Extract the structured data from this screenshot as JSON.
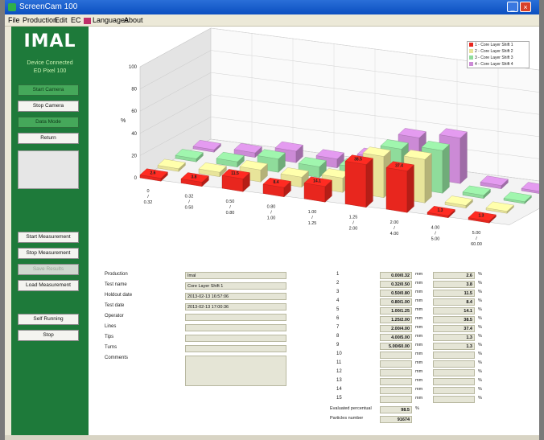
{
  "window": {
    "title": "ScreenCam 100"
  },
  "menu": [
    "File",
    "Production",
    "Edit",
    "EC",
    "Languages",
    "About"
  ],
  "sidebar": {
    "logo": "IMAL",
    "sub1": "Device Connected",
    "sub2": "ED Pixel 100",
    "buttons_top": [
      {
        "label": "Start Camera",
        "state": "active"
      },
      {
        "label": "Stop Camera",
        "state": "normal"
      },
      {
        "label": "Data Mode",
        "state": "active"
      },
      {
        "label": "Return",
        "state": "normal"
      }
    ],
    "buttons_bottom": [
      {
        "label": "Start Measurement",
        "state": "normal"
      },
      {
        "label": "Stop Measurement",
        "state": "normal"
      },
      {
        "label": "Save Results",
        "state": "disabled"
      },
      {
        "label": "Load Measurement",
        "state": "normal"
      },
      {
        "label": "Self Running",
        "state": "normal"
      },
      {
        "label": "Stop",
        "state": "normal"
      }
    ]
  },
  "chart_data": {
    "type": "bar",
    "ylabel": "%",
    "ylim": [
      0,
      100
    ],
    "yticks": [
      0,
      20,
      40,
      60,
      80,
      100
    ],
    "categories": [
      "0 / 0.32",
      "0.32 / 0.50",
      "0.50 / 0.80",
      "0.80 / 1.00",
      "1.00 / 1.25",
      "1.25 / 2.00",
      "2.00 / 4.00",
      "4.00 / 5.00",
      "5.00 / 60.00"
    ],
    "series": [
      {
        "name": "1 - Core Layer Shift 1",
        "color": "#e8261e",
        "values": [
          2.6,
          3.8,
          11.5,
          8.4,
          14.1,
          38.5,
          37.4,
          1.3,
          1.3
        ],
        "labels": [
          "2.6",
          "3.8",
          "11.5",
          "8.4",
          "14.1",
          "38.5",
          "37.4",
          "1.3",
          "1.3"
        ]
      },
      {
        "name": "2 - Core Layer Shift 2",
        "color": "#e8e49a",
        "values": [
          2.5,
          4.0,
          10.8,
          9.0,
          12.9,
          37.1,
          39.1,
          2.4,
          1.5
        ],
        "labels": []
      },
      {
        "name": "3 - Core Layer Shift 3",
        "color": "#8fdc9b",
        "values": [
          2.8,
          4.8,
          12.0,
          9.7,
          13.2,
          35.0,
          38.4,
          2.8,
          1.8
        ],
        "labels": []
      },
      {
        "name": "4 - Core Layer Shift 4",
        "color": "#cc8ad6",
        "values": [
          2.2,
          4.1,
          10.3,
          8.0,
          14.0,
          36.5,
          41.0,
          3.0,
          2.0
        ],
        "labels": []
      }
    ]
  },
  "fields": [
    {
      "label": "Production",
      "value": "Imal"
    },
    {
      "label": "Test name",
      "value": "Core Layer Shift 1"
    },
    {
      "label": "Holdout date",
      "value": "2013-02-13 16:57:06"
    },
    {
      "label": "Test date",
      "value": "2013-02-13 17:00:36"
    },
    {
      "label": "Operator",
      "value": ""
    },
    {
      "label": "Lines",
      "value": ""
    },
    {
      "label": "Tips",
      "value": ""
    },
    {
      "label": "Turns",
      "value": ""
    },
    {
      "label": "Comments",
      "value": ""
    }
  ],
  "ranges": [
    {
      "idx": "1",
      "range": "0.00/0.32",
      "unit": "mm",
      "value": "2.6",
      "pct": "%"
    },
    {
      "idx": "2",
      "range": "0.32/0.50",
      "unit": "mm",
      "value": "3.8",
      "pct": "%"
    },
    {
      "idx": "3",
      "range": "0.50/0.80",
      "unit": "mm",
      "value": "11.5",
      "pct": "%"
    },
    {
      "idx": "4",
      "range": "0.80/1.00",
      "unit": "mm",
      "value": "8.4",
      "pct": "%"
    },
    {
      "idx": "5",
      "range": "1.00/1.25",
      "unit": "mm",
      "value": "14.1",
      "pct": "%"
    },
    {
      "idx": "6",
      "range": "1.25/2.00",
      "unit": "mm",
      "value": "38.5",
      "pct": "%"
    },
    {
      "idx": "7",
      "range": "2.00/4.00",
      "unit": "mm",
      "value": "37.4",
      "pct": "%"
    },
    {
      "idx": "8",
      "range": "4.00/5.00",
      "unit": "mm",
      "value": "1.3",
      "pct": "%"
    },
    {
      "idx": "9",
      "range": "5.00/60.00",
      "unit": "mm",
      "value": "1.3",
      "pct": "%"
    },
    {
      "idx": "10",
      "range": "",
      "unit": "mm",
      "value": "",
      "pct": "%"
    },
    {
      "idx": "11",
      "range": "",
      "unit": "mm",
      "value": "",
      "pct": "%"
    },
    {
      "idx": "12",
      "range": "",
      "unit": "mm",
      "value": "",
      "pct": "%"
    },
    {
      "idx": "13",
      "range": "",
      "unit": "mm",
      "value": "",
      "pct": "%"
    },
    {
      "idx": "14",
      "range": "",
      "unit": "mm",
      "value": "",
      "pct": "%"
    },
    {
      "idx": "15",
      "range": "",
      "unit": "mm",
      "value": "",
      "pct": "%"
    }
  ],
  "summary": {
    "evaluated_label": "Evaluated percentual",
    "evaluated_value": "98.5",
    "evaluated_unit": "%",
    "particles_label": "Particles number",
    "particles_value": "91674"
  }
}
